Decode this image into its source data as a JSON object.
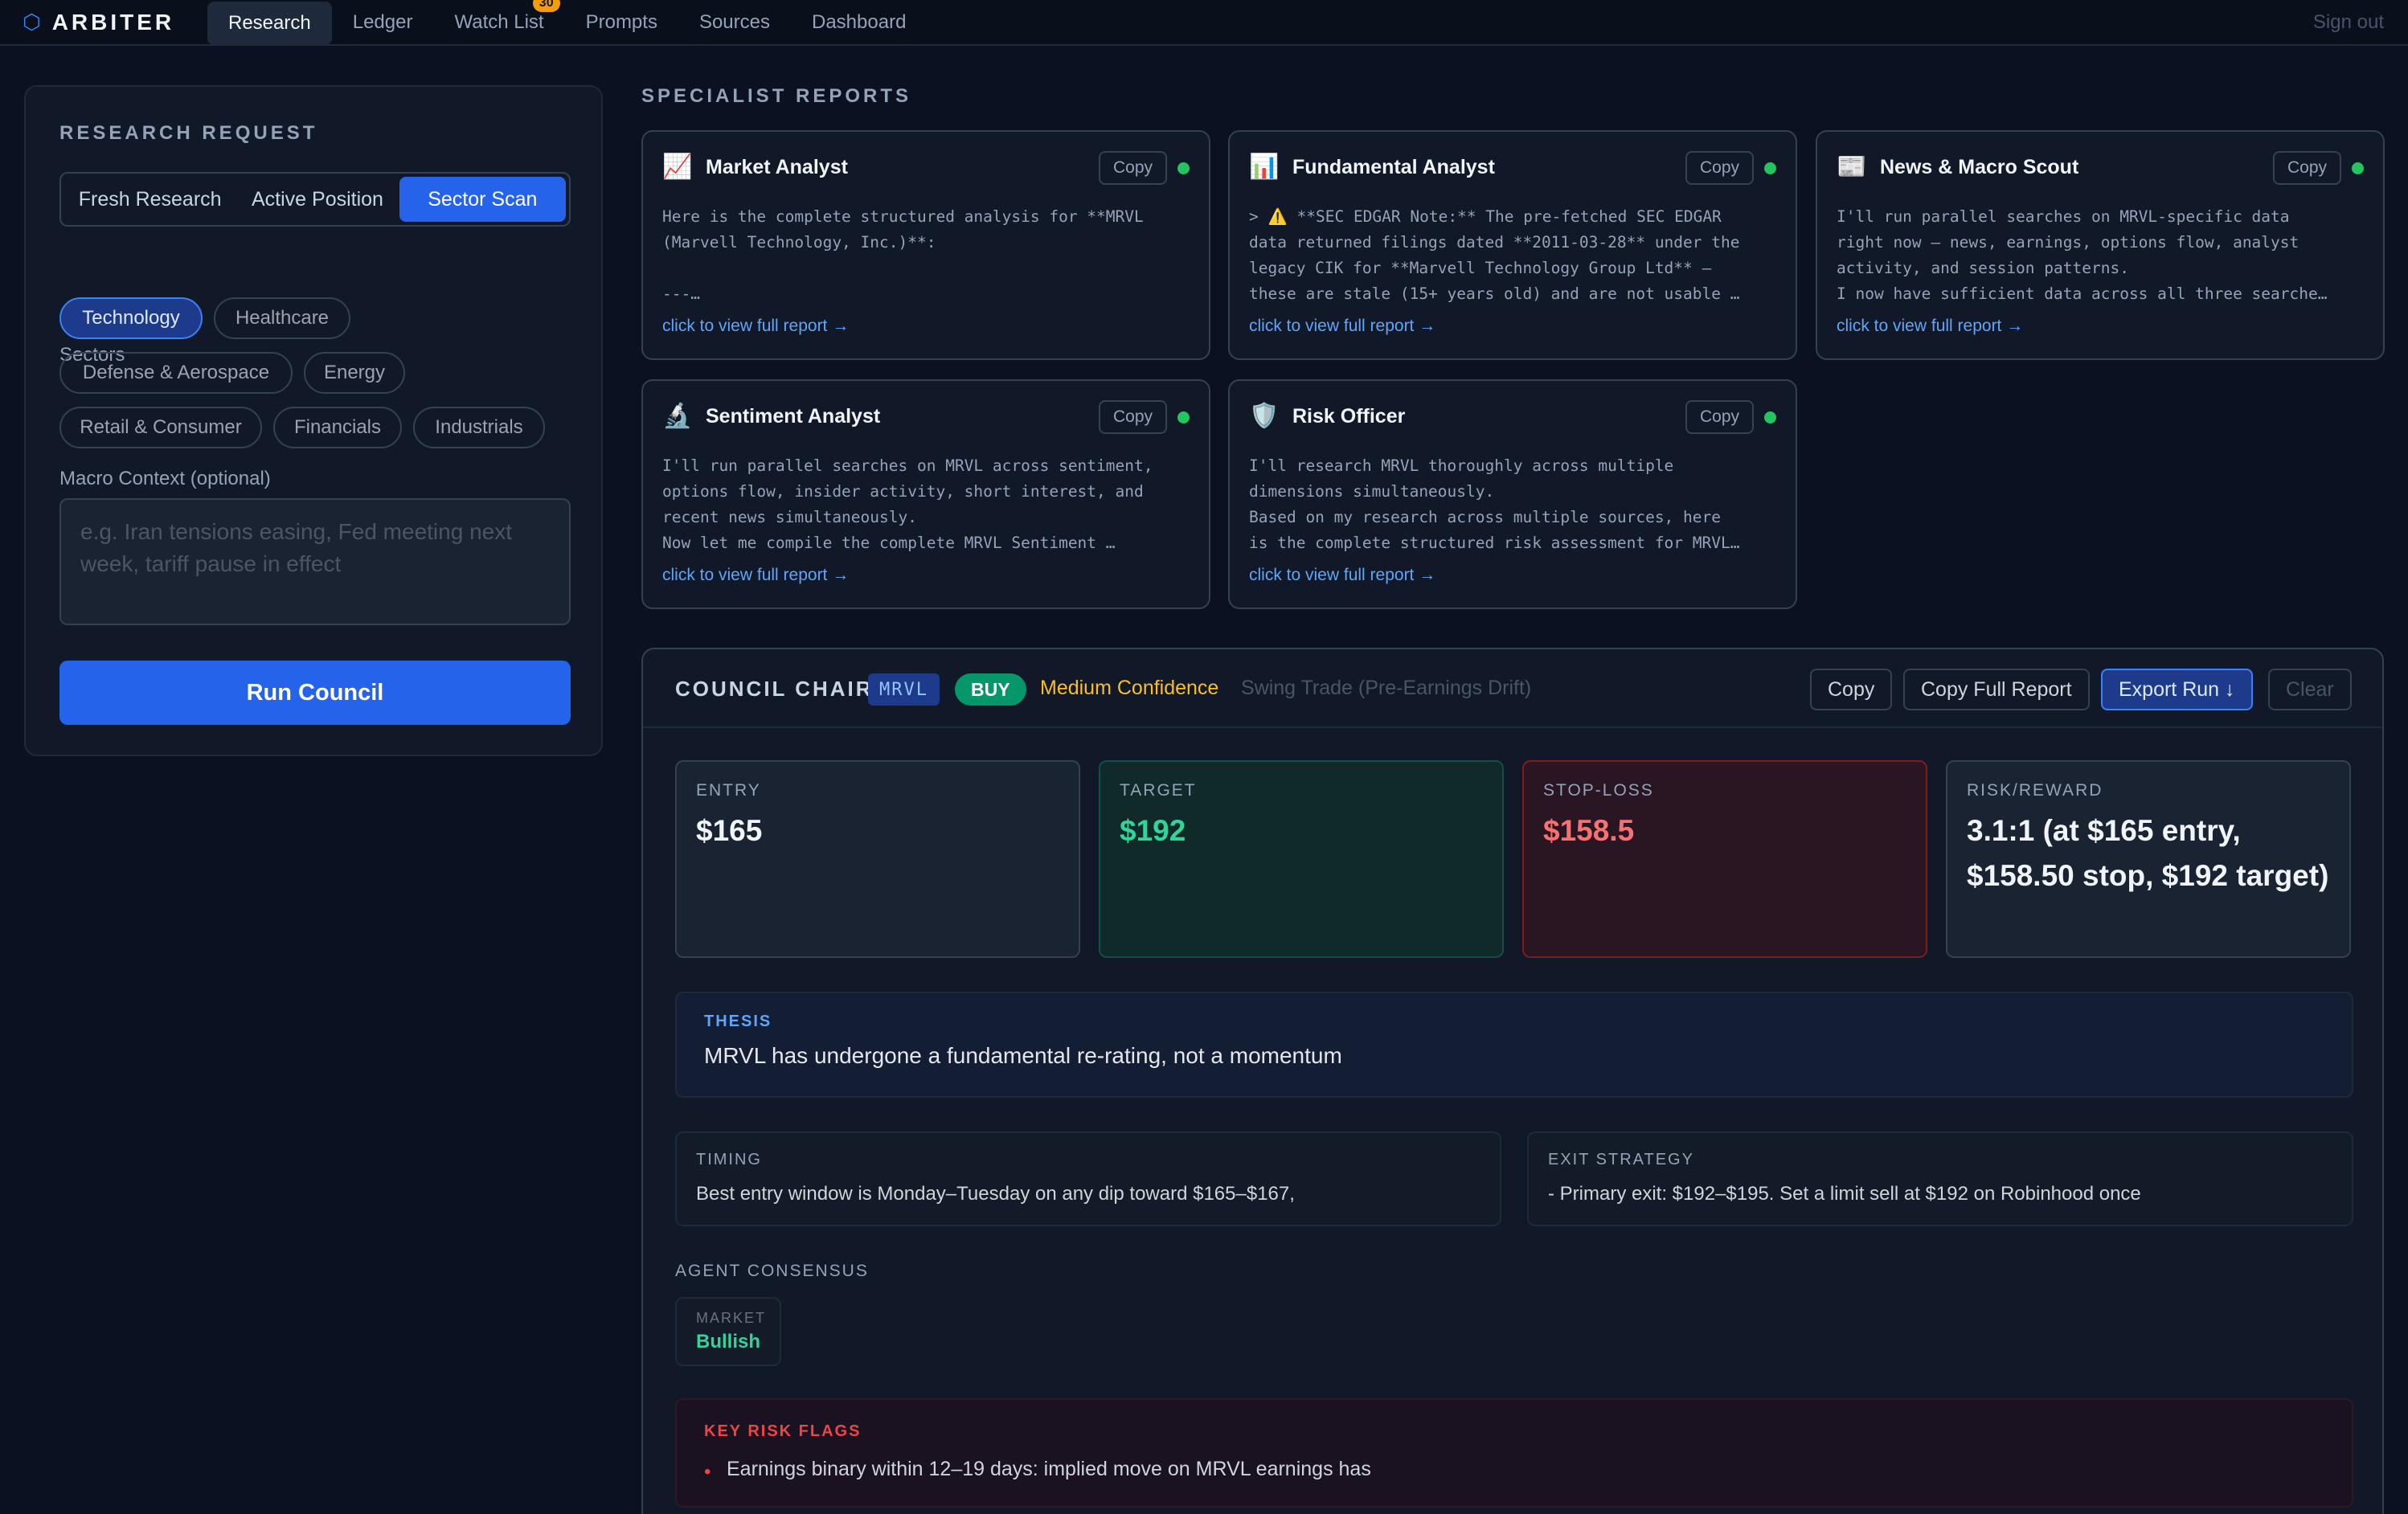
{
  "nav": {
    "brand": "ARBITER",
    "brand_icon": "hexagon-icon",
    "tabs": [
      {
        "label": "Research",
        "active": true
      },
      {
        "label": "Ledger"
      },
      {
        "label": "Watch List",
        "badge": "30"
      },
      {
        "label": "Prompts"
      },
      {
        "label": "Sources"
      },
      {
        "label": "Dashboard"
      }
    ],
    "sign_out": "Sign out"
  },
  "research_request": {
    "heading": "RESEARCH REQUEST",
    "modes": [
      "Fresh Research",
      "Active Position",
      "Sector Scan"
    ],
    "selected_mode": "Sector Scan",
    "sectors_label": "Sectors",
    "sectors": [
      "Technology",
      "Healthcare",
      "Defense & Aerospace",
      "Energy",
      "Retail & Consumer",
      "Financials",
      "Industrials"
    ],
    "selected_sector": "Technology",
    "macro_label": "Macro Context (optional)",
    "macro_placeholder": "e.g. Iran tensions easing, Fed meeting next week, tariff pause in effect",
    "macro_value": "",
    "run_button": "Run Council"
  },
  "specialist_reports": {
    "heading": "SPECIALIST REPORTS",
    "copy_label": "Copy",
    "link_label": "click to view full report →",
    "status_color": "#22c55e",
    "reports": [
      {
        "icon": "chart-increasing-icon",
        "title": "Market Analyst",
        "preview": "Here is the complete structured analysis for **MRVL\n(Marvell Technology, Inc.)**:\n\n---…"
      },
      {
        "icon": "bar-chart-icon",
        "title": "Fundamental Analyst",
        "preview": "> ⚠️ **SEC EDGAR Note:** The pre-fetched SEC EDGAR\ndata returned filings dated **2011-03-28** under the\nlegacy CIK for **Marvell Technology Group Ltd** —\nthese are stale (15+ years old) and are not usable …"
      },
      {
        "icon": "newspaper-icon",
        "title": "News & Macro Scout",
        "preview": "I'll run parallel searches on MRVL-specific data\nright now — news, earnings, options flow, analyst\nactivity, and session patterns.\nI now have sufficient data across all three searche…"
      },
      {
        "icon": "microscope-icon",
        "title": "Sentiment Analyst",
        "preview": "I'll run parallel searches on MRVL across sentiment,\noptions flow, insider activity, short interest, and\nrecent news simultaneously.\nNow let me compile the complete MRVL Sentiment …"
      },
      {
        "icon": "shield-icon",
        "title": "Risk Officer",
        "preview": "I'll research MRVL thoroughly across multiple\ndimensions simultaneously.\nBased on my research across multiple sources, here\nis the complete structured risk assessment for MRVL…"
      }
    ]
  },
  "council": {
    "title": "COUNCIL CHAIR",
    "ticker": "MRVL",
    "action": "BUY",
    "confidence": "Medium Confidence",
    "style": "Swing Trade (Pre-Earnings Drift)",
    "buttons": {
      "copy": "Copy",
      "copy_full": "Copy Full Report",
      "export": "Export Run ↓",
      "clear": "Clear"
    },
    "metrics": [
      {
        "label": "ENTRY",
        "value": "$165"
      },
      {
        "label": "TARGET",
        "value": "$192"
      },
      {
        "label": "STOP-LOSS",
        "value": "$158.5"
      },
      {
        "label": "RISK/REWARD",
        "value": "3.1:1 (at $165 entry, $158.50 stop, $192 target)"
      }
    ],
    "thesis_label": "THESIS",
    "thesis": "MRVL has undergone a fundamental re-rating, not a momentum",
    "timing_label": "TIMING",
    "timing": "Best entry window is Monday–Tuesday on any dip toward $165–$167,",
    "exit_label": "EXIT STRATEGY",
    "exit": "- Primary exit: $192–$195. Set a limit sell at $192 on Robinhood once",
    "consensus_label": "AGENT CONSENSUS",
    "consensus": [
      {
        "agent": "MARKET",
        "view": "Bullish"
      }
    ],
    "risk_label": "KEY RISK FLAGS",
    "risk_flags": [
      "Earnings binary within 12–19 days: implied move on MRVL earnings has"
    ]
  },
  "colors": {
    "accent": "#2563eb",
    "buy": "#059669",
    "bullish": "#34d399",
    "confidence": "#fbbf24",
    "danger": "#ef4444"
  }
}
